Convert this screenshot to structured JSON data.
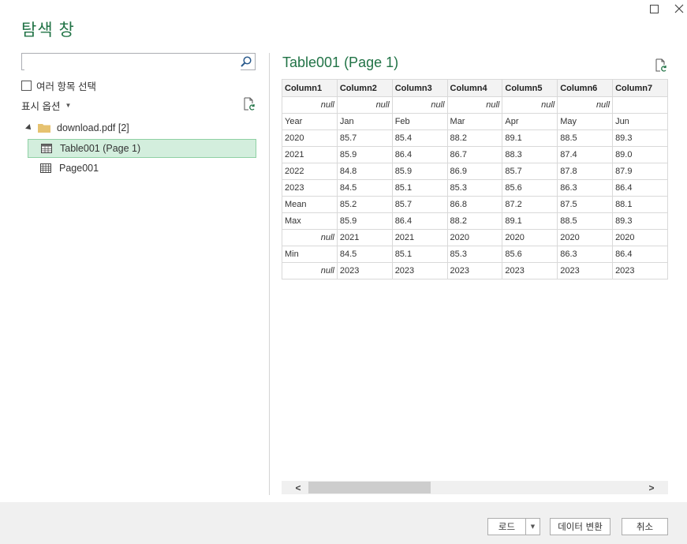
{
  "window": {
    "title": "탐색 창",
    "maximize_icon": "square-icon",
    "close_icon": "x-icon"
  },
  "left": {
    "search": {
      "placeholder": "",
      "value": ""
    },
    "multi_select_label": "여러 항목 선택",
    "display_options_label": "표시 옵션",
    "tree": {
      "folder": {
        "name": "download.pdf",
        "count": "[2]"
      },
      "items": [
        {
          "label": "Table001 (Page 1)",
          "icon": "table-icon",
          "selected": true
        },
        {
          "label": "Page001",
          "icon": "page-grid-icon",
          "selected": false
        }
      ]
    }
  },
  "preview": {
    "title": "Table001 (Page 1)",
    "columns": [
      "Column1",
      "Column2",
      "Column3",
      "Column4",
      "Column5",
      "Column6",
      "Column7"
    ],
    "rows": [
      [
        "null",
        "null",
        "null",
        "null",
        "null",
        "null",
        ""
      ],
      [
        "Year",
        "Jan",
        "Feb",
        "Mar",
        "Apr",
        "May",
        "Jun"
      ],
      [
        "2020",
        "85.7",
        "85.4",
        "88.2",
        "89.1",
        "88.5",
        "89.3"
      ],
      [
        "2021",
        "85.9",
        "86.4",
        "86.7",
        "88.3",
        "87.4",
        "89.0"
      ],
      [
        "2022",
        "84.8",
        "85.9",
        "86.9",
        "85.7",
        "87.8",
        "87.9"
      ],
      [
        "2023",
        "84.5",
        "85.1",
        "85.3",
        "85.6",
        "86.3",
        "86.4"
      ],
      [
        "Mean",
        "85.2",
        "85.7",
        "86.8",
        "87.2",
        "87.5",
        "88.1"
      ],
      [
        "Max",
        "85.9",
        "86.4",
        "88.2",
        "89.1",
        "88.5",
        "89.3"
      ],
      [
        "null",
        "2021",
        "2021",
        "2020",
        "2020",
        "2020",
        "2020"
      ],
      [
        "Min",
        "84.5",
        "85.1",
        "85.3",
        "85.6",
        "86.3",
        "86.4"
      ],
      [
        "null",
        "2023",
        "2023",
        "2023",
        "2023",
        "2023",
        "2023"
      ]
    ]
  },
  "footer": {
    "load_label": "로드",
    "transform_label": "데이터 변환",
    "cancel_label": "취소"
  },
  "colors": {
    "accent": "#217346",
    "selection_bg": "#d3eedd",
    "footer_bg": "#f0f0f0"
  }
}
